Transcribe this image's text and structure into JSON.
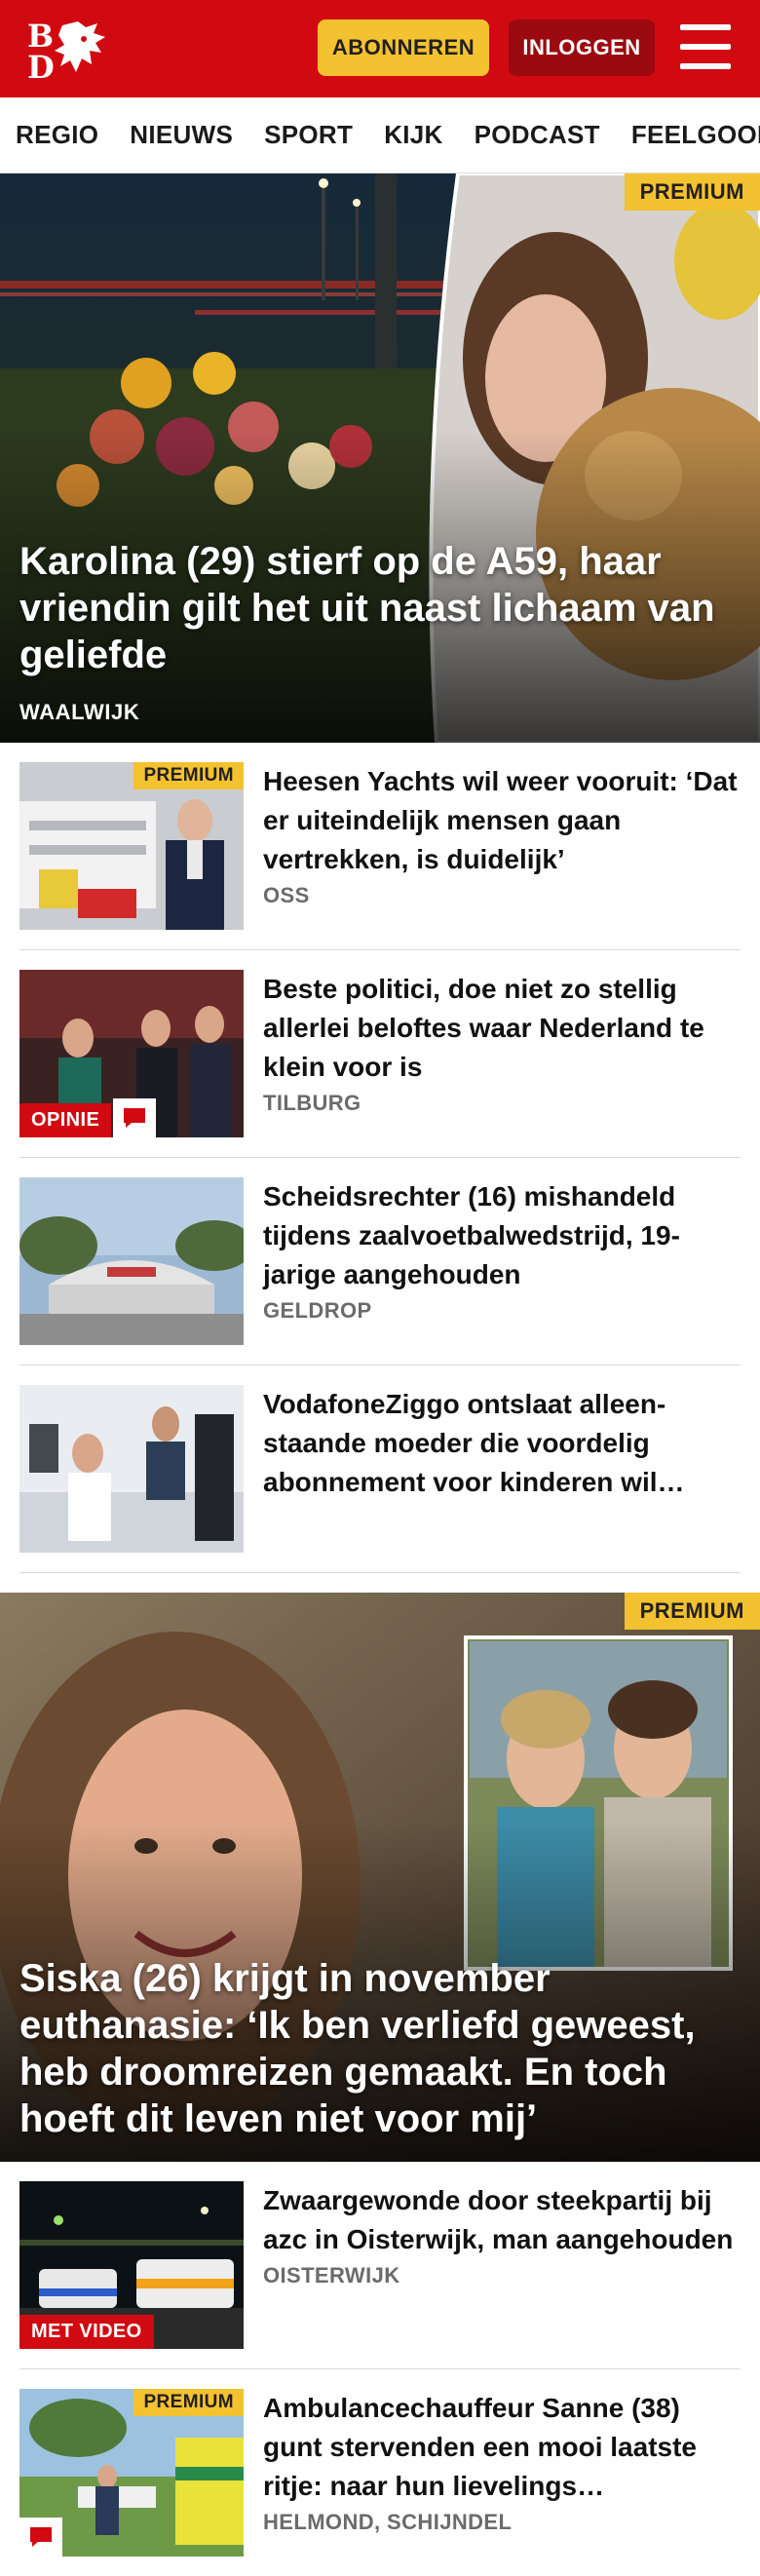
{
  "header": {
    "logo_text": "BD",
    "subscribe_label": "ABONNEREN",
    "login_label": "INLOGGEN"
  },
  "nav": {
    "items": [
      "REGIO",
      "NIEUWS",
      "SPORT",
      "KIJK",
      "PODCAST",
      "FEELGOOD"
    ]
  },
  "hero1": {
    "badge": "PREMIUM",
    "title": "Karolina (29) stierf op de A59, haar vriendin gilt het uit naast lichaam van geliefde",
    "region": "WAALWIJK"
  },
  "articles": [
    {
      "badge": "PREMIUM",
      "title": "Heesen Yachts wil weer vooruit: ‘Dat er uiteindelijk mensen gaan vertrekken, is duidelijk’",
      "region": "OSS"
    },
    {
      "label": "OPINIE",
      "title": "Beste politici, doe niet zo stellig allerlei beloftes waar Nederland te klein voor is",
      "region": "TILBURG"
    },
    {
      "title": "Scheidsrechter (16) mishandeld tijdens zaalvoetbalwedstrijd, 19-jarige aangehouden",
      "region": "GELDROP"
    },
    {
      "title": "VodafoneZiggo ontslaat alleen-staande moeder die voordelig abonnement voor kinderen wil…",
      "region": ""
    }
  ],
  "hero2": {
    "badge": "PREMIUM",
    "title": "Siska (26) krijgt in november euthanasie: ‘Ik ben verliefd geweest, heb droomreizen gemaakt. En toch hoeft dit leven niet voor mij’"
  },
  "articles2": [
    {
      "label": "MET VIDEO",
      "title": "Zwaargewonde door steekpartij bij azc in Oisterwijk, man aangehouden",
      "region": "OISTERWIJK"
    },
    {
      "badge": "PREMIUM",
      "title": "Ambulancechauffeur Sanne (38) gunt stervenden een mooi laatste ritje: naar hun lievelings…",
      "region": "HELMOND, SCHIJNDEL"
    }
  ],
  "colors": {
    "brand_red": "#d10a11",
    "premium_yellow": "#f3c230",
    "login_dark_red": "#9b0a10"
  }
}
